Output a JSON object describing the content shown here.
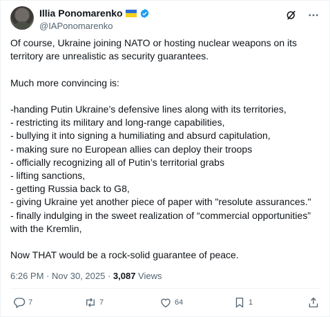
{
  "author": {
    "display_name": "Illia Ponomarenko",
    "handle": "@IAPonomarenko"
  },
  "icons": {
    "flag": "ukraine-flag-icon",
    "verified": "verified-badge-icon",
    "grok": "grok-icon",
    "more": "more-options-icon",
    "reply": "reply-icon",
    "repost": "repost-icon",
    "like": "like-icon",
    "bookmark": "bookmark-icon",
    "share": "share-icon"
  },
  "colors": {
    "verified": "#1d9bf0",
    "muted": "#536471",
    "text": "#0f1419"
  },
  "tweet": {
    "p1": "Of course, Ukraine joining NATO or hosting nuclear weapons on its territory are unrealistic as security guarantees.",
    "p2": "Much more convincing is:",
    "list": [
      "-handing Putin Ukraine’s defensive lines along with its territories,",
      "- restricting its military and  long-range capabilities,",
      "- bullying it into signing a humiliating and absurd capitulation,",
      "- making sure no European allies can deploy their troops",
      "- officially recognizing all of Putin’s territorial grabs",
      "- lifting sanctions,",
      "- getting Russia back to G8,",
      "- giving Ukraine yet another piece of paper with \"resolute assurances.\"",
      "-  finally indulging in the sweet realization of “commercial opportunities” with the Kremlin,"
    ],
    "p3": "Now THAT would be a rock-solid guarantee of peace."
  },
  "meta": {
    "time": "6:26 PM",
    "sep": " · ",
    "date": "Nov 30, 2025",
    "views_count": "3,087",
    "views_label": " Views"
  },
  "actions": {
    "replies": "7",
    "reposts": "7",
    "likes": "64",
    "bookmarks": "1"
  }
}
